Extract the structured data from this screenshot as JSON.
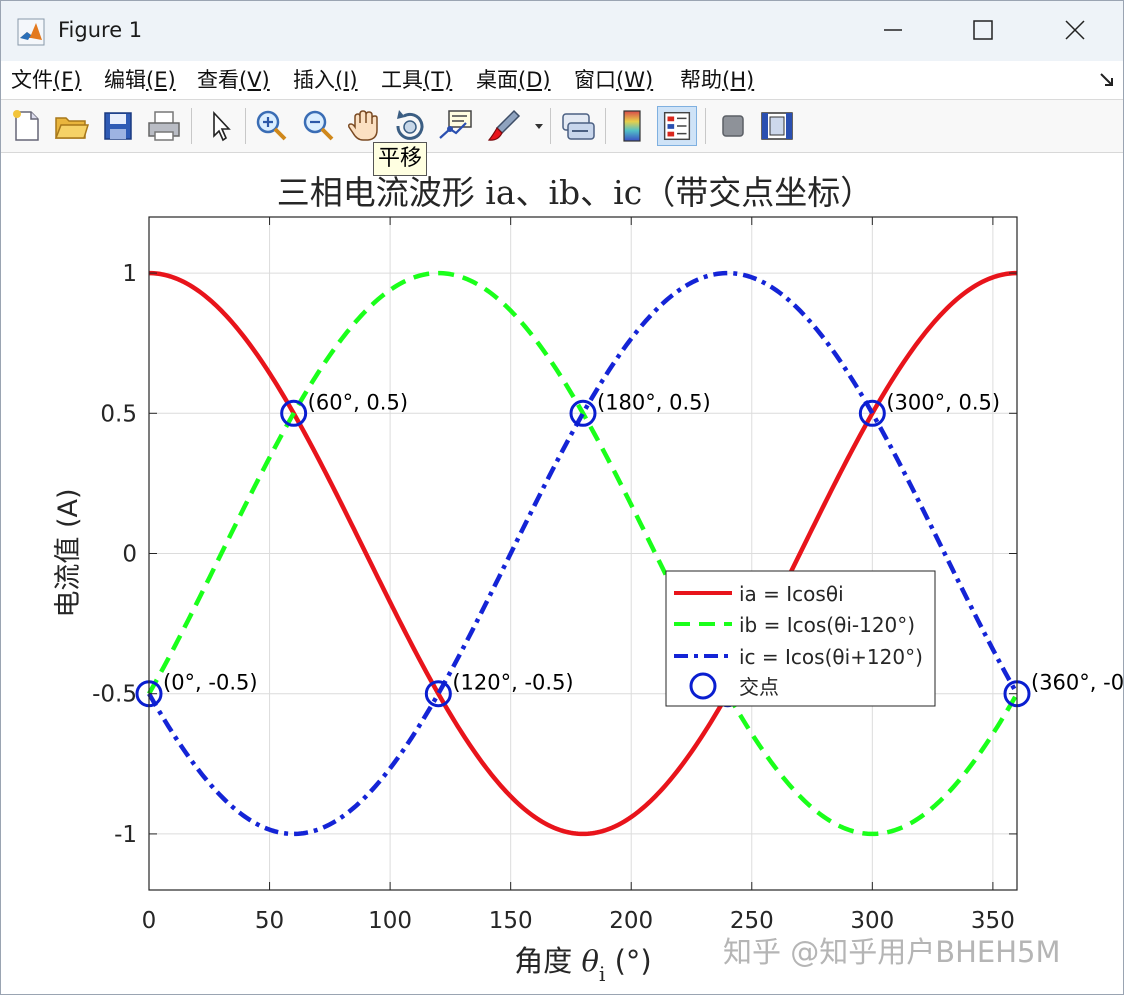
{
  "window": {
    "title": "Figure 1",
    "tooltip": "平移"
  },
  "menu": {
    "items": [
      {
        "label": "文件",
        "key": "(F)"
      },
      {
        "label": "编辑",
        "key": "(E)"
      },
      {
        "label": "查看",
        "key": "(V)"
      },
      {
        "label": "插入",
        "key": "(I)"
      },
      {
        "label": "工具",
        "key": "(T)"
      },
      {
        "label": "桌面",
        "key": "(D)"
      },
      {
        "label": "窗口",
        "key": "(W)"
      },
      {
        "label": "帮助",
        "key": "(H)"
      }
    ]
  },
  "toolbar": {
    "buttons": [
      {
        "icon": "new-figure-icon"
      },
      {
        "icon": "open-folder-icon"
      },
      {
        "icon": "save-icon"
      },
      {
        "icon": "print-icon"
      },
      {
        "icon": "select-arrow-icon"
      },
      {
        "icon": "zoom-in-icon"
      },
      {
        "icon": "zoom-out-icon"
      },
      {
        "icon": "pan-hand-icon",
        "pressed": false
      },
      {
        "icon": "rotate-3d-icon"
      },
      {
        "icon": "data-cursor-icon"
      },
      {
        "icon": "brush-icon"
      },
      {
        "icon": "link-plot-icon"
      },
      {
        "icon": "colorbar-icon"
      },
      {
        "icon": "legend-icon",
        "pressed": true
      },
      {
        "icon": "hide-plot-tools-icon"
      },
      {
        "icon": "show-plot-tools-icon"
      }
    ]
  },
  "watermark": "知乎 @知乎用户BHEH5M",
  "colors": {
    "ia": "#e8141b",
    "ib": "#1aff1a",
    "ic": "#1424d6",
    "marker": "#0a1ed0"
  },
  "chart_data": {
    "type": "line",
    "title": "三相电流波形 ia、ib、ic（带交点坐标）",
    "xlabel_prefix": "角度 ",
    "xlabel_symbol": "θ",
    "xlabel_sub": "i",
    "xlabel_suffix": " (°)",
    "ylabel": "电流值 (A)",
    "xlim": [
      0,
      360
    ],
    "ylim": [
      -1.2,
      1.2
    ],
    "xticks": [
      0,
      50,
      100,
      150,
      200,
      250,
      300,
      350
    ],
    "yticks": [
      -1,
      -0.5,
      0,
      0.5,
      1
    ],
    "grid": true,
    "series": [
      {
        "name": "ia = Icosθi",
        "phase_deg": 0,
        "style": "solid"
      },
      {
        "name": "ib = Icos(θi-120°)",
        "phase_deg": -120,
        "style": "dashed"
      },
      {
        "name": "ic = Icos(θi+120°)",
        "phase_deg": 120,
        "style": "dashdot"
      }
    ],
    "intersections": {
      "name": "交点",
      "points": [
        {
          "x": 0,
          "y": -0.5,
          "label": "(0°, -0.5)"
        },
        {
          "x": 60,
          "y": 0.5,
          "label": "(60°, 0.5)"
        },
        {
          "x": 120,
          "y": -0.5,
          "label": "(120°, -0.5)"
        },
        {
          "x": 180,
          "y": 0.5,
          "label": "(180°, 0.5)"
        },
        {
          "x": 240,
          "y": -0.5,
          "label": ""
        },
        {
          "x": 300,
          "y": 0.5,
          "label": "(300°, 0.5)"
        },
        {
          "x": 360,
          "y": -0.5,
          "label": "(360°, -0"
        }
      ]
    },
    "legend_position": "lower-right-center"
  }
}
